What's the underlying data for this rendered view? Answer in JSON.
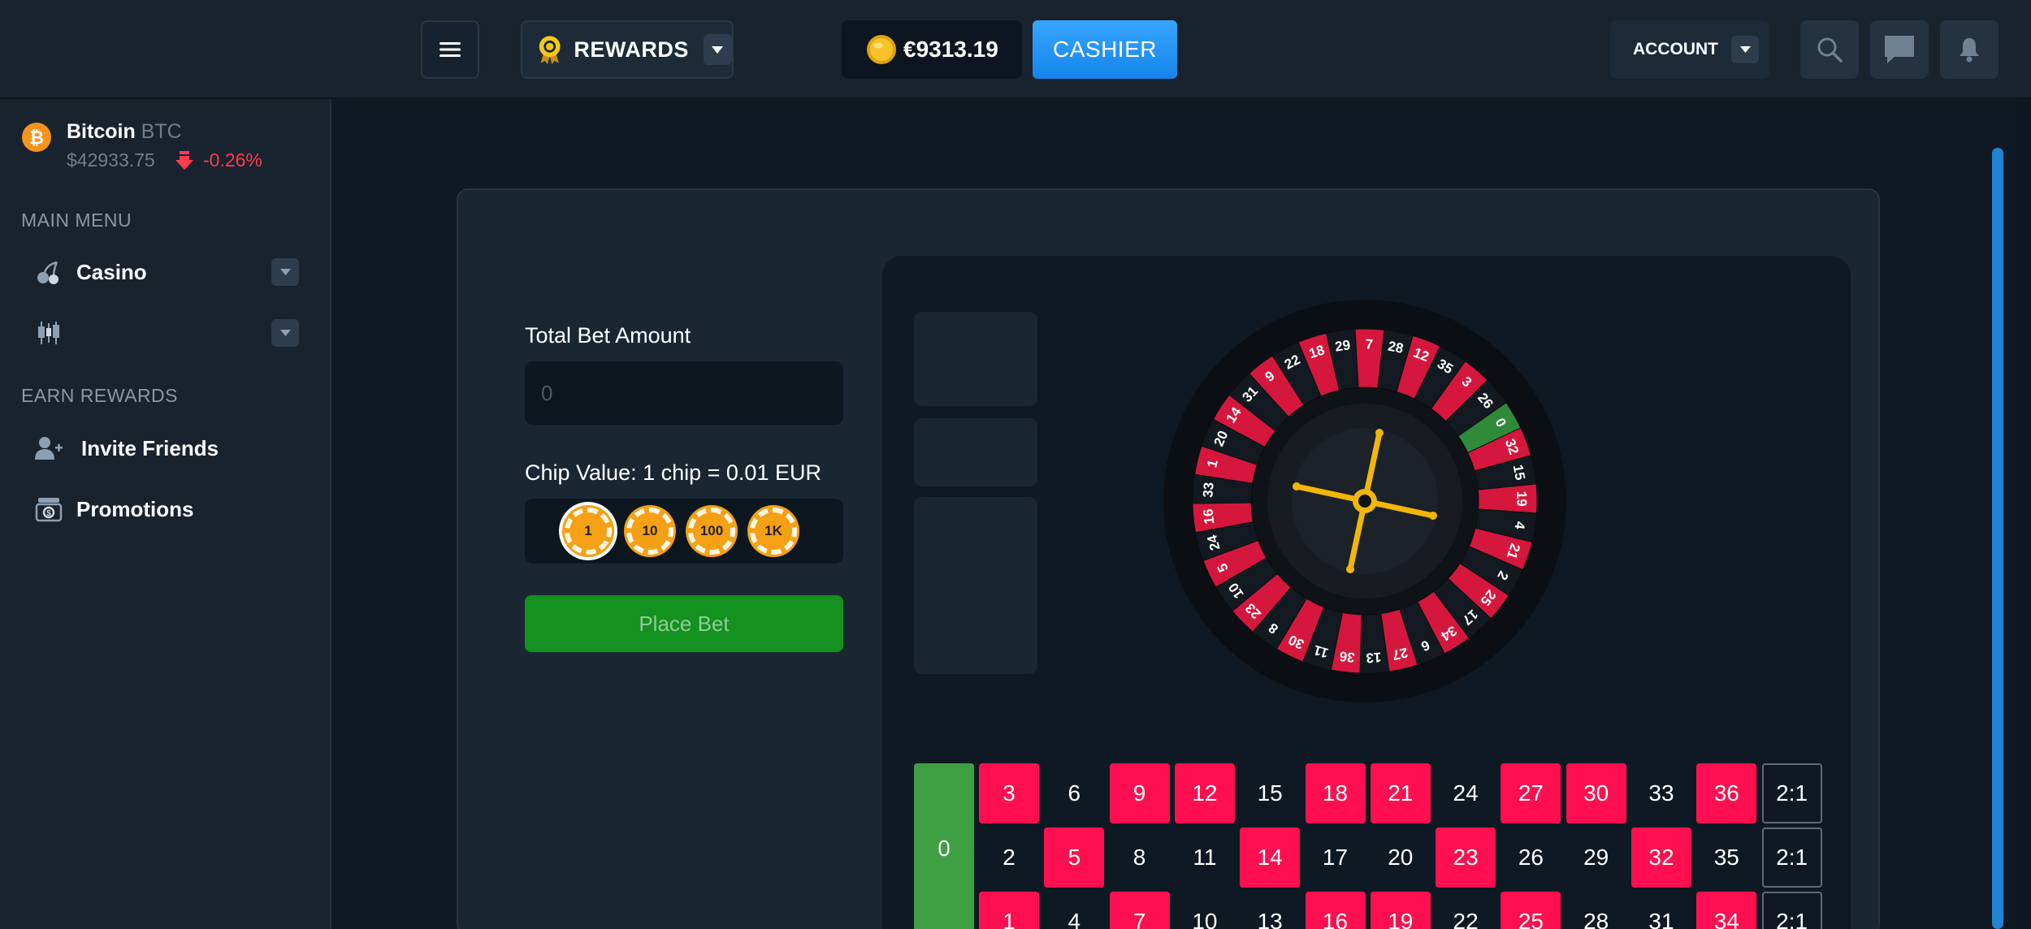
{
  "header": {
    "rewards_label": "REWARDS",
    "balance": "€9313.19",
    "cashier_label": "CASHIER",
    "account_label": "ACCOUNT"
  },
  "sidebar": {
    "crypto": {
      "name": "Bitcoin",
      "symbol": "BTC",
      "price": "$42933.75",
      "change": "-0.26%"
    },
    "main_menu_title": "MAIN MENU",
    "casino_label": "Casino",
    "earn_rewards_title": "EARN REWARDS",
    "invite_label": "Invite Friends",
    "promotions_label": "Promotions"
  },
  "game": {
    "total_bet_label": "Total Bet Amount",
    "bet_placeholder": "0",
    "chip_value_label": "Chip Value: 1 chip = 0.01 EUR",
    "chips": [
      "1",
      "10",
      "100",
      "1K"
    ],
    "place_bet_label": "Place Bet"
  },
  "wheel": {
    "numbers": [
      0,
      32,
      15,
      19,
      4,
      21,
      2,
      25,
      17,
      34,
      6,
      27,
      13,
      36,
      11,
      30,
      8,
      23,
      10,
      5,
      24,
      16,
      33,
      1,
      20,
      14,
      31,
      9,
      22,
      18,
      29,
      7,
      28,
      12,
      35,
      3,
      26
    ],
    "red_numbers": [
      1,
      3,
      5,
      7,
      9,
      12,
      14,
      16,
      18,
      19,
      21,
      23,
      25,
      27,
      30,
      32,
      34,
      36
    ]
  },
  "table": {
    "zero": "0",
    "rows": [
      [
        "3",
        "6",
        "9",
        "12",
        "15",
        "18",
        "21",
        "24",
        "27",
        "30",
        "33",
        "36"
      ],
      [
        "2",
        "5",
        "8",
        "11",
        "14",
        "17",
        "20",
        "23",
        "26",
        "29",
        "32",
        "35"
      ],
      [
        "1",
        "4",
        "7",
        "10",
        "13",
        "16",
        "19",
        "22",
        "25",
        "28",
        "31",
        "34"
      ]
    ],
    "column_bet_label": "2:1"
  },
  "colors": {
    "red": "#ff0f4f",
    "green": "#3ea043",
    "accent_blue": "#1f8ef0",
    "gold": "#f5c518"
  }
}
